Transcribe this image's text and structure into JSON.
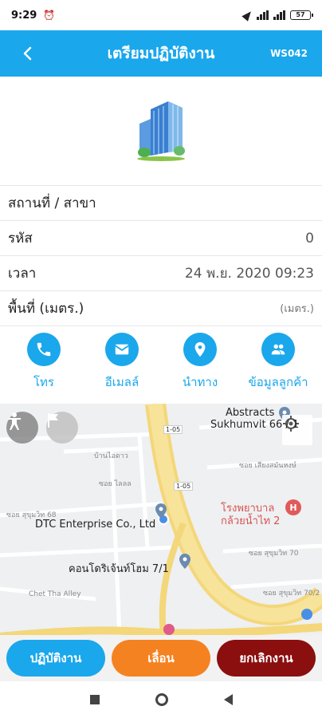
{
  "status_bar": {
    "time": "9:29",
    "battery": "57"
  },
  "header": {
    "title": "เตรียมปฏิบัติงาน",
    "code": "WS042",
    "back_icon": "chevron-left-icon",
    "color": "#1aa7ec"
  },
  "logo": {
    "icon": "office-building-logo"
  },
  "info": {
    "rows": [
      {
        "label": "สถานที่ / สาขา",
        "value": ""
      },
      {
        "label": "รหัส",
        "value": "0"
      },
      {
        "label": "เวลา",
        "value": "24 พ.ย. 2020 09:23"
      },
      {
        "label": "พื้นที่ (เมตร.)",
        "value": "(เมตร.)"
      }
    ]
  },
  "actions": [
    {
      "label": "โทร",
      "icon": "phone-icon"
    },
    {
      "label": "อีเมลล์",
      "icon": "email-icon"
    },
    {
      "label": "นำทาง",
      "icon": "location-pin-icon"
    },
    {
      "label": "ข้อมูลลูกค้า",
      "icon": "people-icon"
    }
  ],
  "map": {
    "labels": {
      "abstracts": "Abstracts",
      "sukhumvit": "Sukhumvit 66 / 1",
      "hospital_1": "โรงพยาบาล",
      "hospital_2": "กล้วยน้ำไท 2",
      "dtc": "DTC Enterprise Co., Ltd",
      "condo": "คอนโดริเจ้นท์โฮม 7/1",
      "alley": "Chet Tha Alley",
      "soi_a": "ซอย สุขุมวิท 68",
      "soi_b": "ซอย เสียงสมันหงษ์",
      "soi_c": "ซอย สุขุมวิท 70",
      "soi_d": "ซอย สุขุมวิท 70/2",
      "soi_e": "ซอย ไลลล",
      "soi_f": "บ้านไอดาว",
      "road_tag_1": "1-05",
      "road_tag_2": "1-05",
      "hospital_badge": "H"
    }
  },
  "buttons": {
    "start": "ปฏิบัติงาน",
    "postpone": "เลื่อน",
    "cancel": "ยกเลิกงาน"
  }
}
